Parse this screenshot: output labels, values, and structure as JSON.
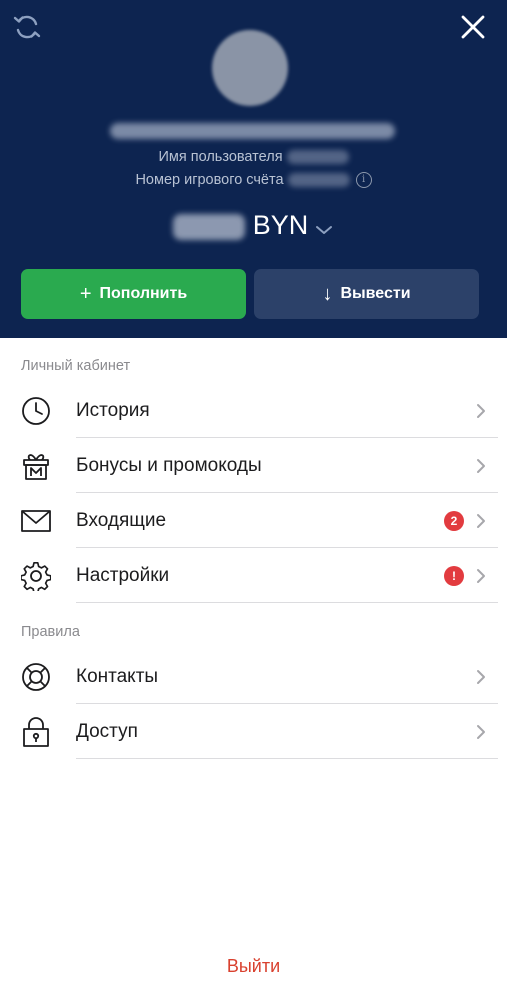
{
  "header": {
    "username_label": "Имя пользователя",
    "account_label": "Номер игрового счёта",
    "info_glyph": "i",
    "currency": "BYN",
    "background_color": "#0d2450",
    "icons": [
      "refresh-icon",
      "close-icon",
      "info-icon",
      "chevron-down-icon"
    ]
  },
  "actions": {
    "deposit_glyph": "+",
    "deposit_label": "Пополнить",
    "deposit_color": "#2aaa4f",
    "withdraw_glyph": "↓",
    "withdraw_label": "Вывести",
    "withdraw_color": "#2c4169"
  },
  "personal": {
    "title": "Личный кабинет",
    "items": [
      {
        "label": "История",
        "icon": "clock-icon"
      },
      {
        "label": "Бонусы и промокоды",
        "icon": "gift-icon"
      },
      {
        "label": "Входящие",
        "icon": "envelope-icon",
        "badge": "2"
      },
      {
        "label": "Настройки",
        "icon": "gear-icon",
        "badge": "!"
      }
    ]
  },
  "rules": {
    "title": "Правила",
    "items": [
      {
        "label": "Контакты",
        "icon": "lifebuoy-icon"
      },
      {
        "label": "Доступ",
        "icon": "lock-icon"
      }
    ]
  },
  "footer": {
    "logout_label": "Выйти",
    "logout_color": "#d9412f",
    "badge_color": "#e23b3f"
  }
}
